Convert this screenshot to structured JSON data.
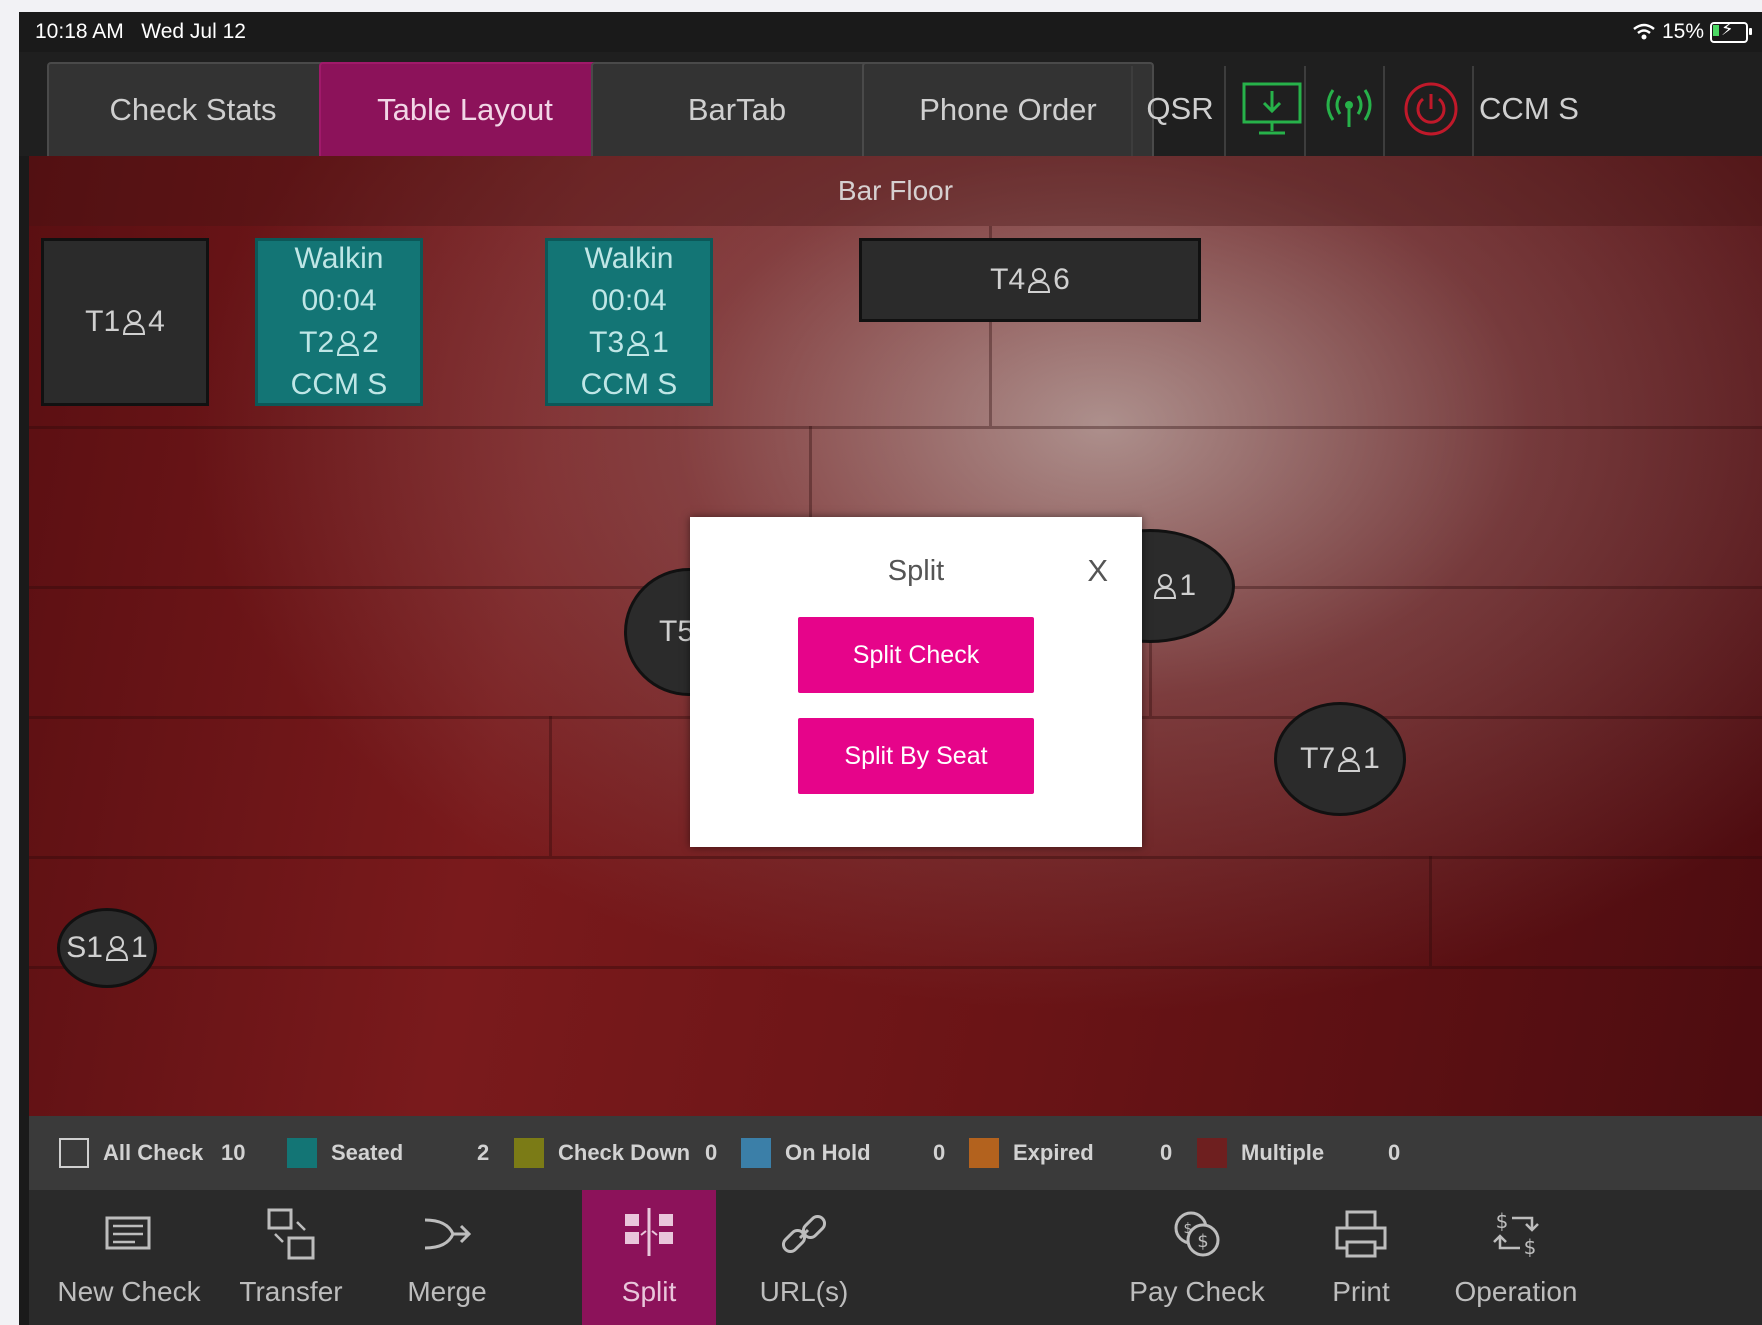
{
  "status_bar": {
    "time": "10:18 AM",
    "date": "Wed Jul 12",
    "battery": "15%"
  },
  "nav": {
    "tabs": [
      "Check Stats",
      "Table Layout",
      "BarTab",
      "Phone Order"
    ],
    "active_tab": "Table Layout",
    "qsr": "QSR",
    "user": "CCM S",
    "icons": [
      "monitor-download-icon",
      "broadcast-icon",
      "power-icon"
    ]
  },
  "floor": {
    "title": "Bar Floor",
    "tables": [
      {
        "name": "T1",
        "guests": "4",
        "shape": "rect",
        "status": ""
      },
      {
        "name": "T2",
        "guests": "2",
        "shape": "rect",
        "status": "seated",
        "line1": "Walkin",
        "time": "00:04",
        "server": "CCM S"
      },
      {
        "name": "T3",
        "guests": "1",
        "shape": "rect",
        "status": "seated",
        "line1": "Walkin",
        "time": "00:04",
        "server": "CCM S"
      },
      {
        "name": "T4",
        "guests": "6",
        "shape": "rect",
        "status": ""
      },
      {
        "name": "T5",
        "shape": "round",
        "status": ""
      },
      {
        "guests": "1",
        "shape": "round",
        "status": ""
      },
      {
        "name": "T7",
        "guests": "1",
        "shape": "round",
        "status": ""
      },
      {
        "name": "S1",
        "guests": "1",
        "shape": "round",
        "status": ""
      }
    ]
  },
  "modal": {
    "title": "Split",
    "close": "X",
    "buttons": [
      "Split Check",
      "Split By Seat"
    ]
  },
  "legend": [
    {
      "label": "All Check",
      "count": "10",
      "color": ""
    },
    {
      "label": "Seated",
      "count": "2",
      "color": "#137575"
    },
    {
      "label": "Check Down",
      "count": "0",
      "color": "#7b7b16"
    },
    {
      "label": "On Hold",
      "count": "0",
      "color": "#3b7fa8"
    },
    {
      "label": "Expired",
      "count": "0",
      "color": "#b3621e"
    },
    {
      "label": "Multiple",
      "count": "0",
      "color": "#6e1f1f"
    }
  ],
  "toolbar": {
    "items": [
      "New Check",
      "Transfer",
      "Merge",
      "Split",
      "URL(s)",
      "Pay Check",
      "Print",
      "Operation"
    ],
    "active": "Split"
  },
  "colors": {
    "accent": "#e6048a",
    "active_tab": "#8c125a",
    "seated": "#137575"
  }
}
